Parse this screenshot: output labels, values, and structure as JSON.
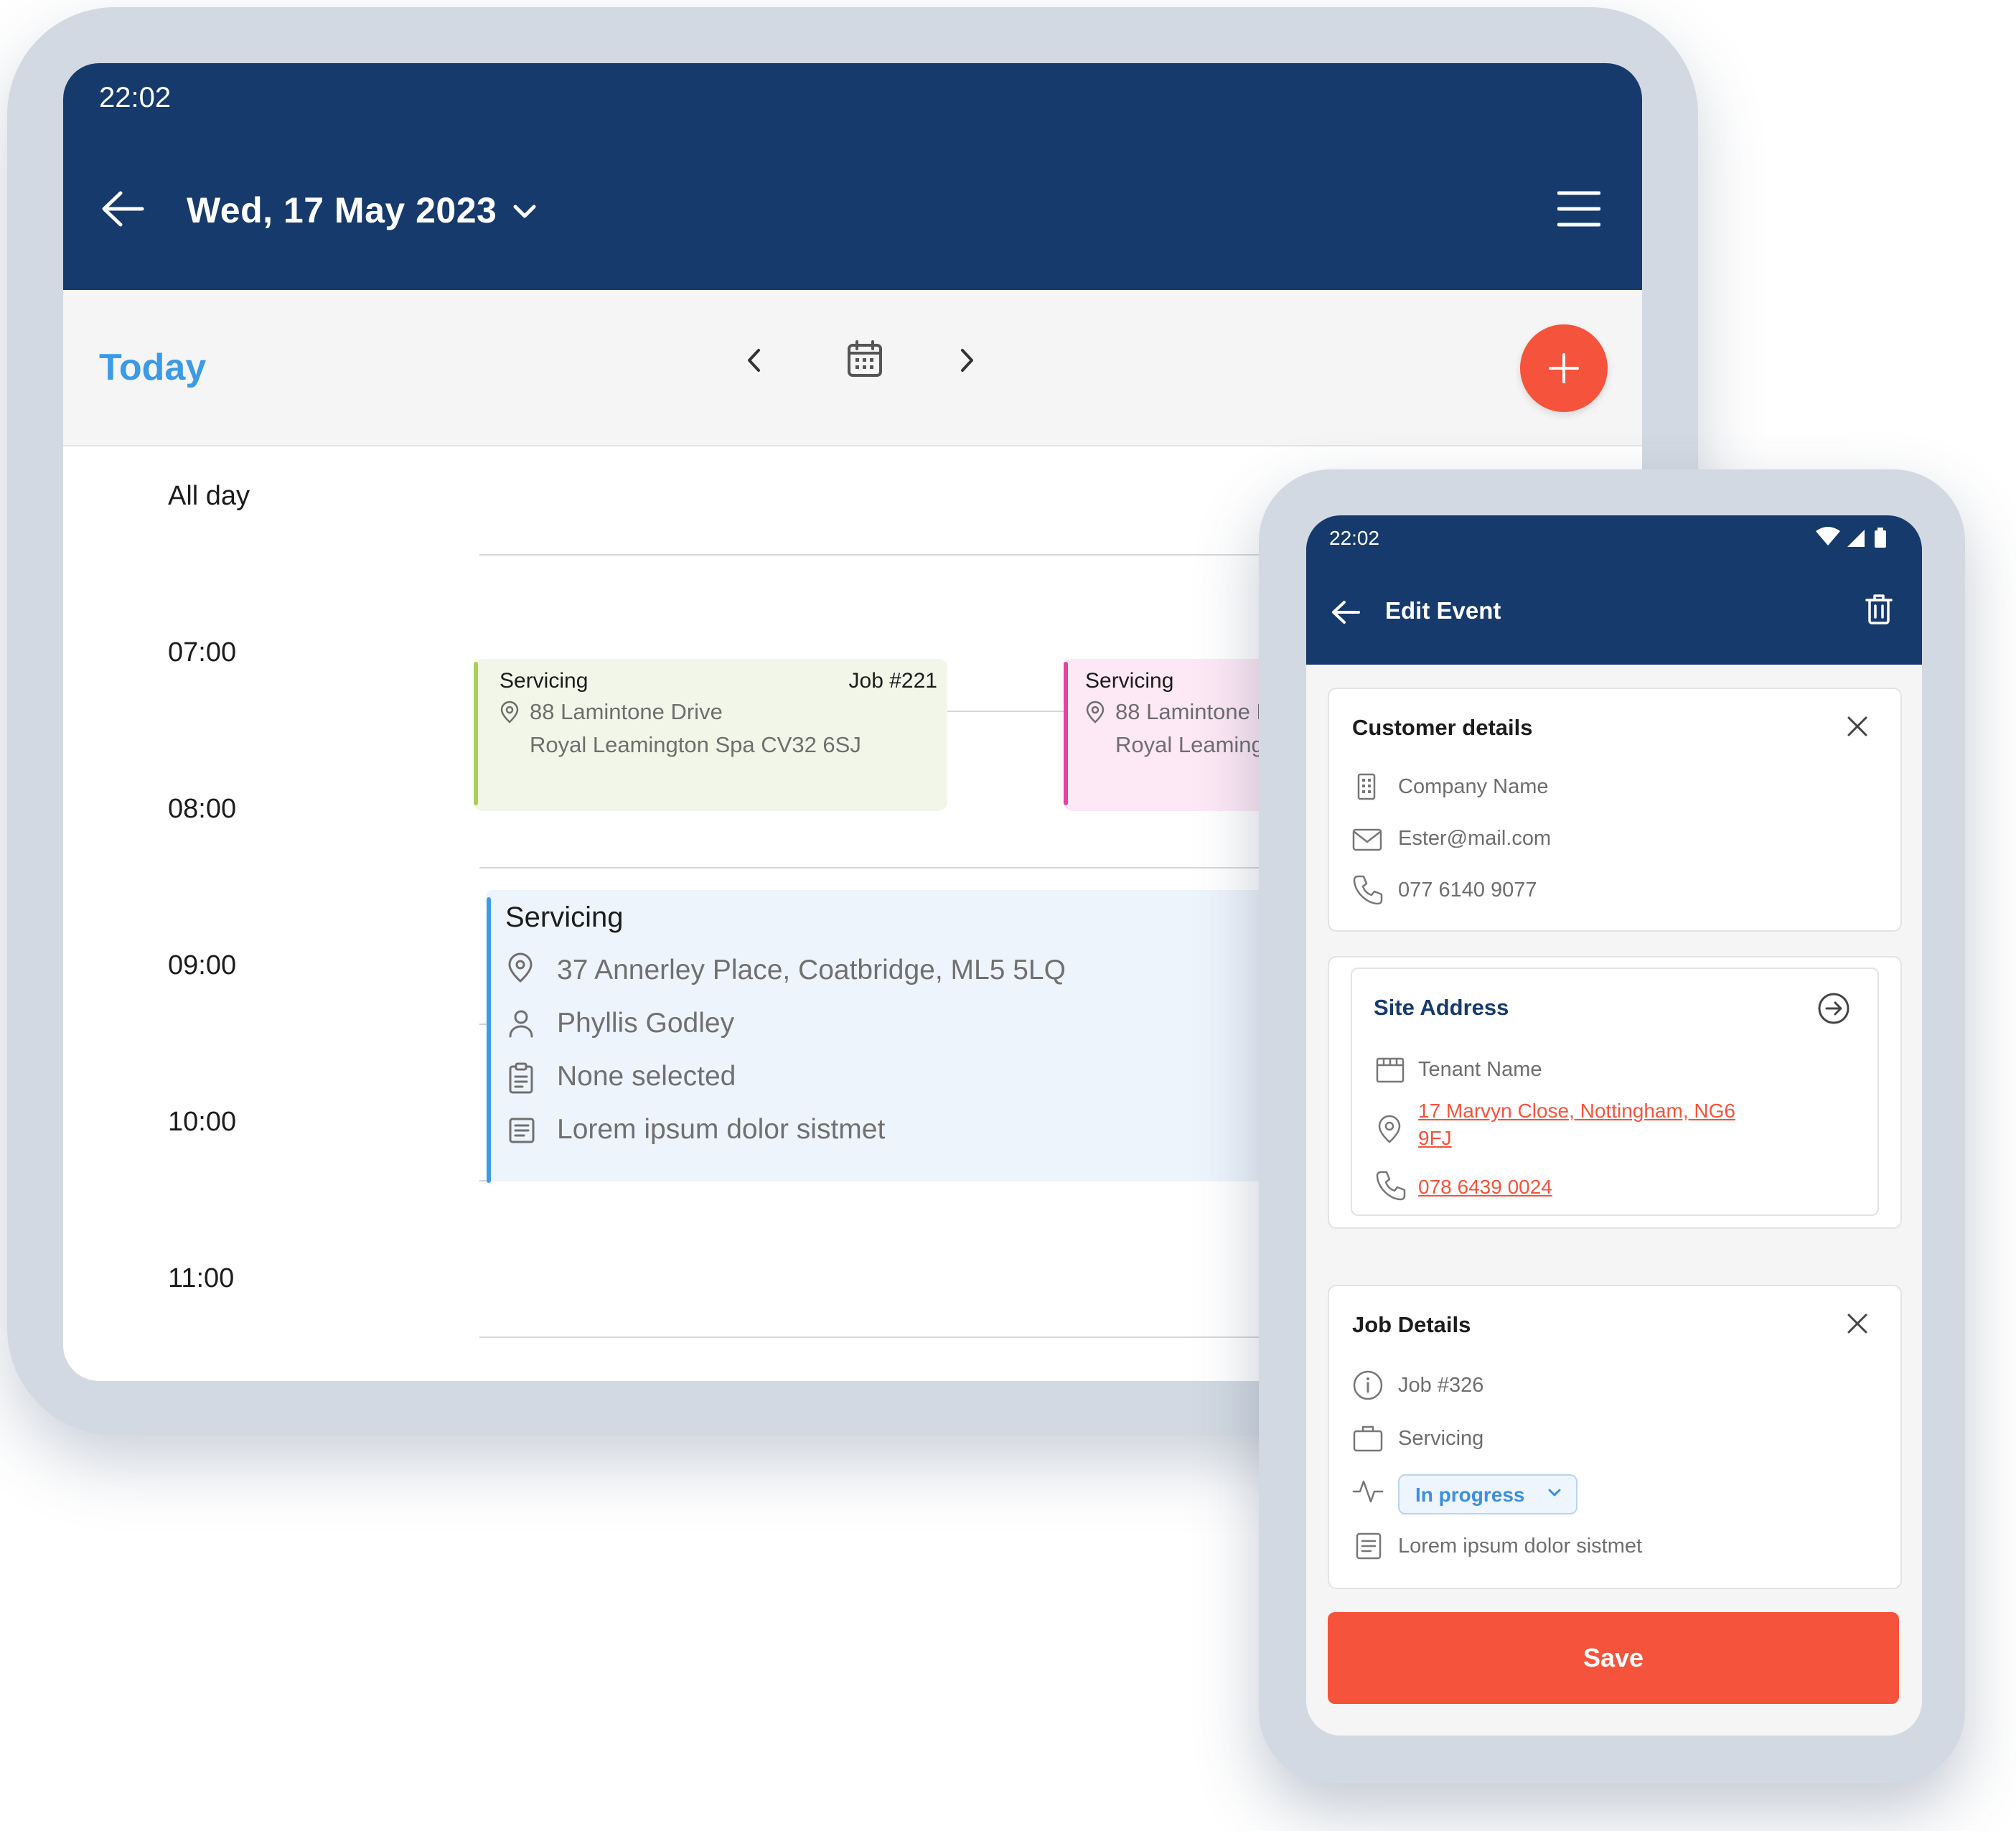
{
  "tablet": {
    "status_time": "22:02",
    "header": {
      "date_title": "Wed, 17 May 2023"
    },
    "toolbar": {
      "today_label": "Today",
      "add_label": "+"
    },
    "time_slots": [
      "All day",
      "07:00",
      "08:00",
      "09:00",
      "10:00",
      "11:00"
    ],
    "events": [
      {
        "title": "Servicing",
        "job": "Job #221",
        "address_line1": "88 Lamintone Drive",
        "address_line2": "Royal Leamington Spa CV32 6SJ",
        "color": "#a9cf54"
      },
      {
        "title": "Servicing",
        "address_line1": "88 Lamintone Drive",
        "address_line2": "Royal Leamington Spa CV32 6SJ",
        "color": "#e6429f"
      },
      {
        "title": "Servicing",
        "address": "37 Annerley Place, Coatbridge, ML5 5LQ",
        "contact": "Phyllis Godley",
        "form": "None selected",
        "notes": "Lorem ipsum dolor sistmet",
        "color": "#3c9ae6"
      }
    ]
  },
  "phone": {
    "status_time": "22:02",
    "header": {
      "title": "Edit Event"
    },
    "customer": {
      "title": "Customer details",
      "company_placeholder": "Company Name",
      "email": "Ester@mail.com",
      "phone": "077 6140 9077"
    },
    "site": {
      "title": "Site Address",
      "tenant_placeholder": "Tenant Name",
      "address_line1": "17 Marvyn Close, Nottingham, NG6",
      "address_line2": "9FJ",
      "phone": "078 6439 0024"
    },
    "job": {
      "title": "Job Details",
      "number": "Job #326",
      "type": "Servicing",
      "status": "In progress",
      "notes": "Lorem ipsum dolor sistmet"
    },
    "save_label": "Save"
  },
  "colors": {
    "header_navy": "#163a6b",
    "accent_blue": "#3c9ae6",
    "accent_orange": "#f5533b"
  },
  "icons": [
    "back-arrow-icon",
    "chevron-down-icon",
    "hamburger-menu-icon",
    "chevron-left-icon",
    "calendar-icon",
    "chevron-right-icon",
    "plus-icon",
    "location-pin-icon",
    "person-icon",
    "clipboard-icon",
    "notes-icon",
    "wifi-icon",
    "signal-icon",
    "battery-icon",
    "trash-icon",
    "close-icon",
    "building-icon",
    "mail-icon",
    "phone-icon",
    "arrow-circle-right-icon",
    "storefront-icon",
    "info-icon",
    "briefcase-icon",
    "activity-icon"
  ]
}
